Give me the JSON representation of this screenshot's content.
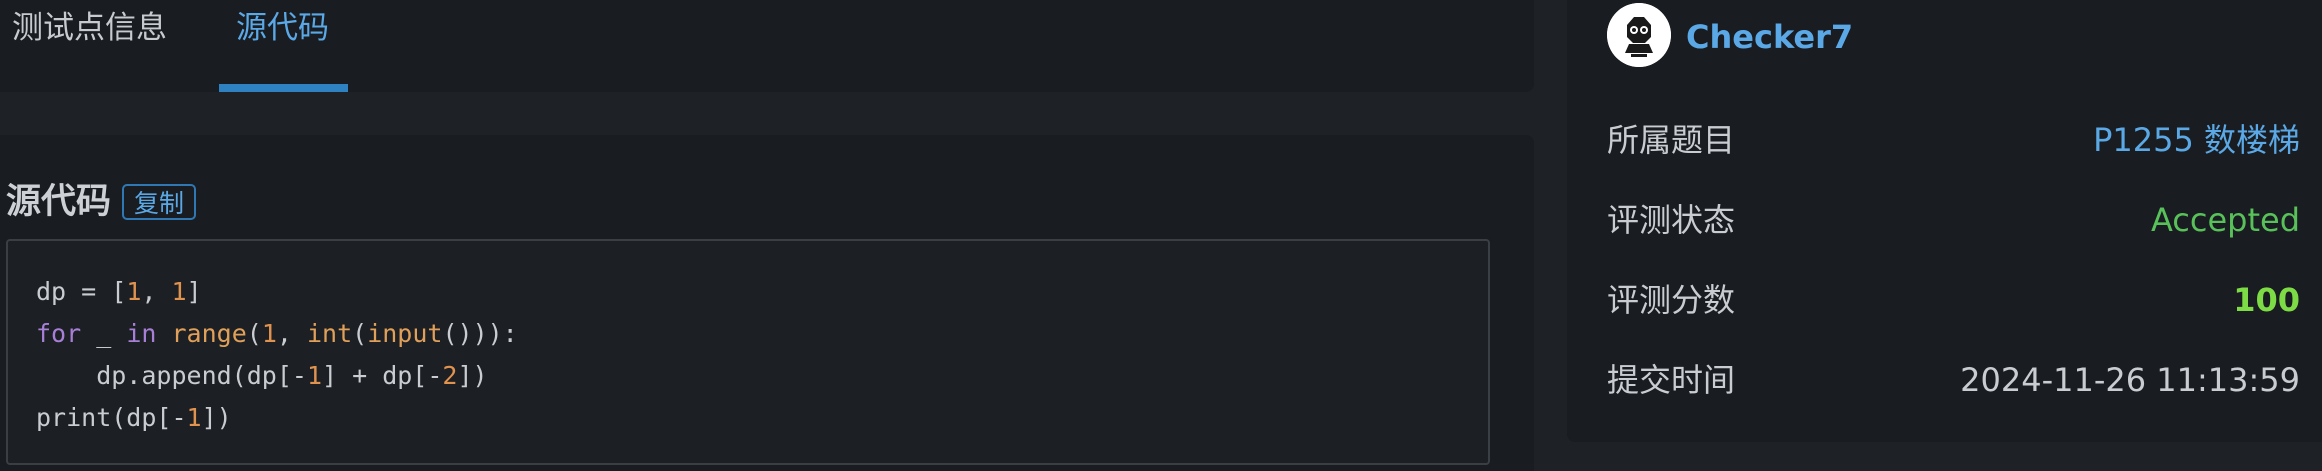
{
  "tabs": [
    {
      "label": "测试点信息",
      "active": false
    },
    {
      "label": "源代码",
      "active": true
    }
  ],
  "source": {
    "title": "源代码",
    "copy_label": "复制"
  },
  "code": {
    "language": "python",
    "lines": [
      [
        {
          "t": "dp = [",
          "c": "plain"
        },
        {
          "t": "1",
          "c": "num"
        },
        {
          "t": ", ",
          "c": "plain"
        },
        {
          "t": "1",
          "c": "num"
        },
        {
          "t": "]",
          "c": "plain"
        }
      ],
      [
        {
          "t": "for",
          "c": "kw"
        },
        {
          "t": " _ ",
          "c": "plain"
        },
        {
          "t": "in",
          "c": "kw"
        },
        {
          "t": " ",
          "c": "plain"
        },
        {
          "t": "range",
          "c": "fn"
        },
        {
          "t": "(",
          "c": "plain"
        },
        {
          "t": "1",
          "c": "num"
        },
        {
          "t": ", ",
          "c": "plain"
        },
        {
          "t": "int",
          "c": "fn"
        },
        {
          "t": "(",
          "c": "plain"
        },
        {
          "t": "input",
          "c": "fn"
        },
        {
          "t": "())):",
          "c": "plain"
        }
      ],
      [
        {
          "t": "    dp.append(dp[-",
          "c": "plain"
        },
        {
          "t": "1",
          "c": "num"
        },
        {
          "t": "] + dp[-",
          "c": "plain"
        },
        {
          "t": "2",
          "c": "num"
        },
        {
          "t": "])",
          "c": "plain"
        }
      ],
      [
        {
          "t": "print(dp[-",
          "c": "plain"
        },
        {
          "t": "1",
          "c": "num"
        },
        {
          "t": "])",
          "c": "plain"
        }
      ]
    ]
  },
  "user": {
    "name": "Checker7",
    "avatar_icon": "user-avatar-icon"
  },
  "info": {
    "problem_label": "所属题目",
    "problem_value": "P1255 数楼梯",
    "status_label": "评测状态",
    "status_value": "Accepted",
    "score_label": "评测分数",
    "score_value": "100",
    "time_label": "提交时间",
    "time_value": "2024-11-26 11:13:59"
  },
  "colors": {
    "background": "#1e2226",
    "card": "#191c20",
    "accent_blue": "#5ba8e6",
    "accepted_green": "#58c15a",
    "score_green": "#7ddc46",
    "keyword_purple": "#a77fd6",
    "function_orange": "#e0a05a",
    "number_orange": "#e0924f"
  }
}
